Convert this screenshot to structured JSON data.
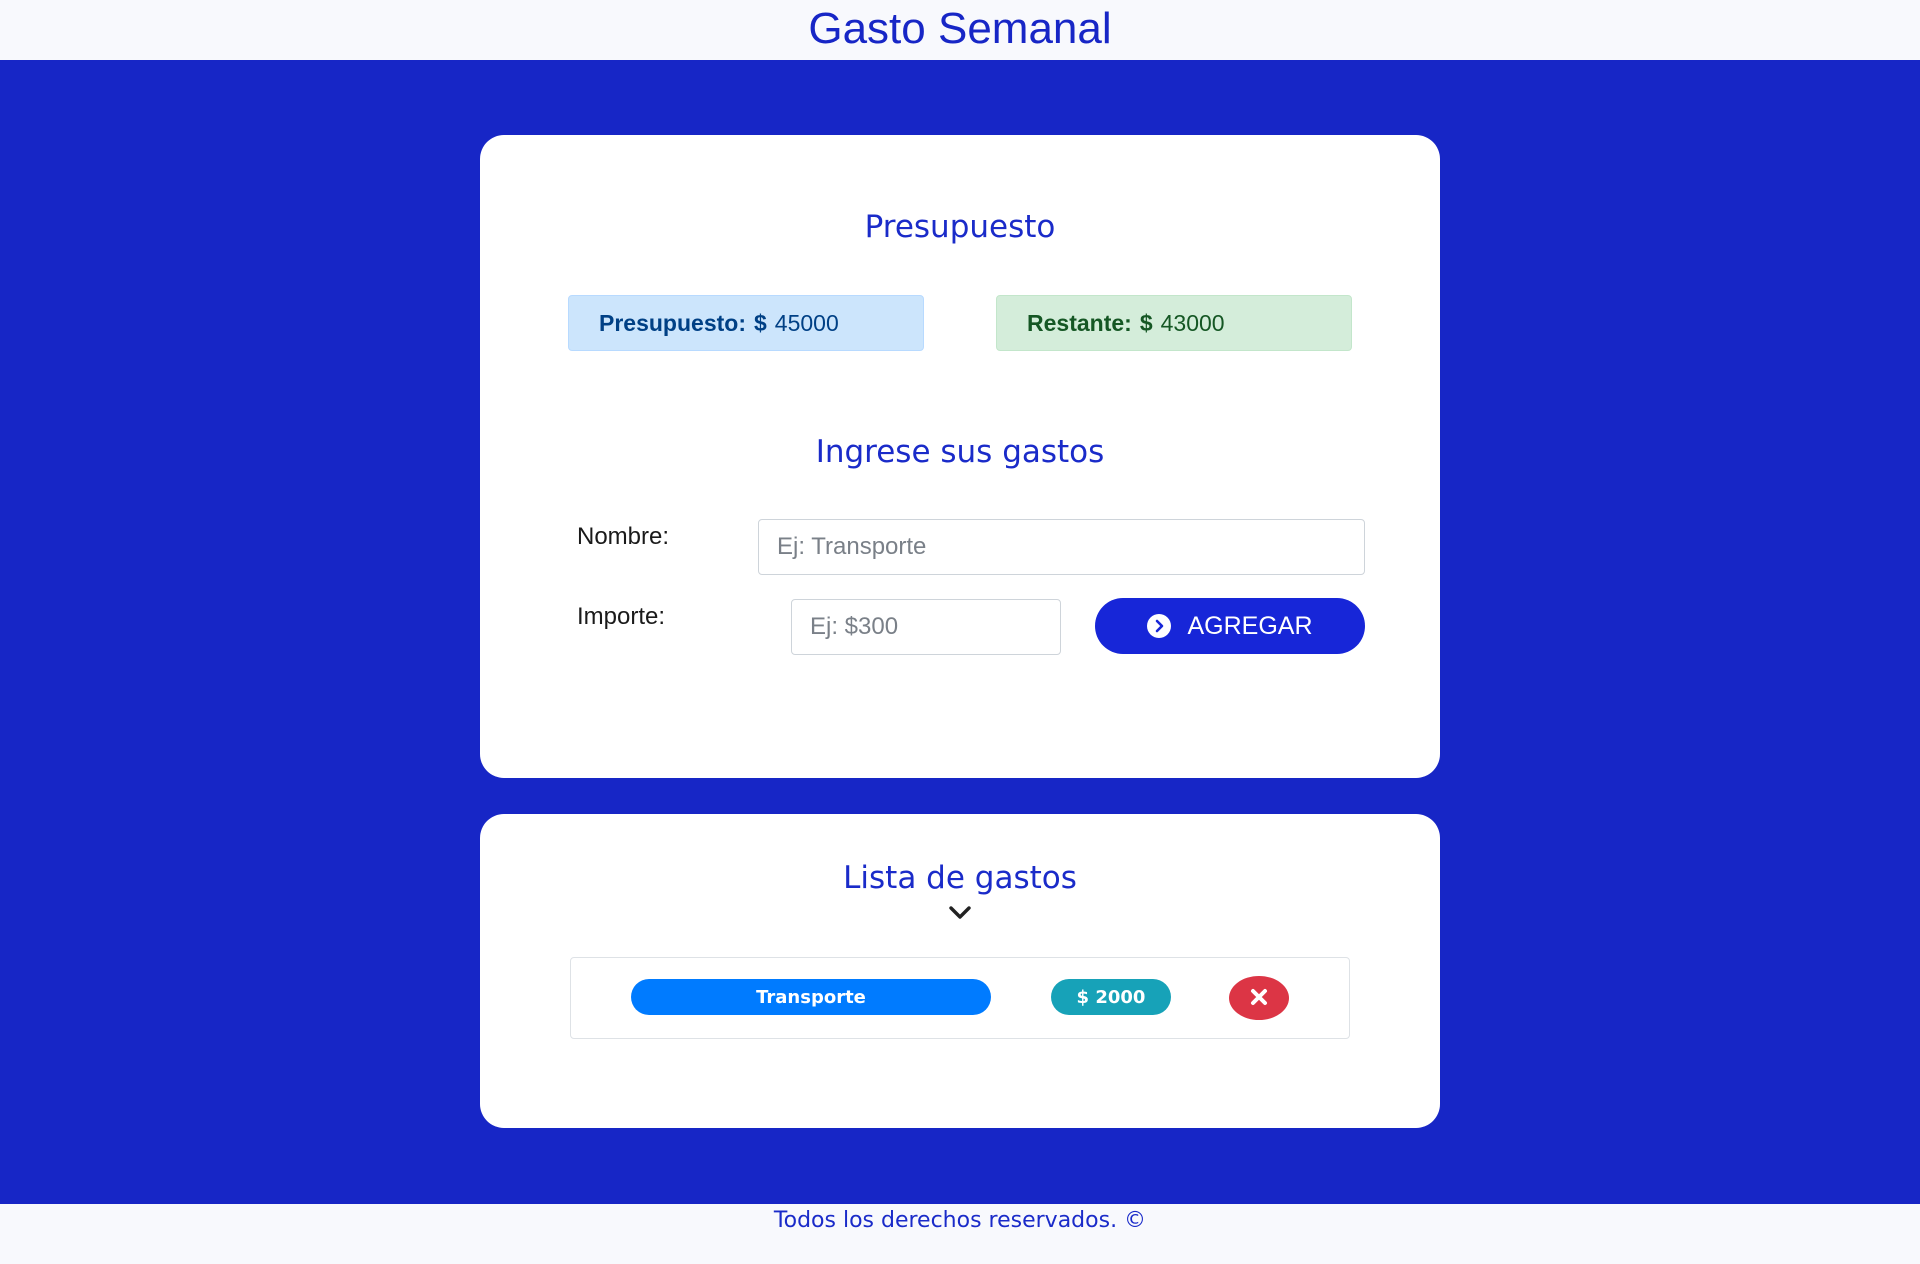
{
  "header": {
    "title": "Gasto Semanal"
  },
  "budget_section": {
    "title": "Presupuesto",
    "budget": {
      "label": "Presupuesto:",
      "currency": "$",
      "value": "45000"
    },
    "remaining": {
      "label": "Restante:",
      "currency": "$",
      "value": "43000"
    }
  },
  "form": {
    "title": "Ingrese sus gastos",
    "name_label": "Nombre:",
    "name_placeholder": "Ej: Transporte",
    "amount_label": "Importe:",
    "amount_placeholder": "Ej: $300",
    "submit_label": "AGREGAR",
    "submit_icon": "chevron-right-circle-icon"
  },
  "expense_list": {
    "title": "Lista de gastos",
    "toggle_icon": "chevron-down-icon",
    "items": [
      {
        "name": "Transporte",
        "amount": "$ 2000",
        "delete_icon": "close-icon"
      }
    ]
  },
  "footer": {
    "text": "Todos los derechos reservados. ©"
  },
  "colors": {
    "primary": "#1726c6",
    "budget_alert": "#cce5fc",
    "remaining_alert": "#d4edda",
    "name_pill": "#007bff",
    "amount_pill": "#17a2b8",
    "delete": "#dc3545"
  }
}
